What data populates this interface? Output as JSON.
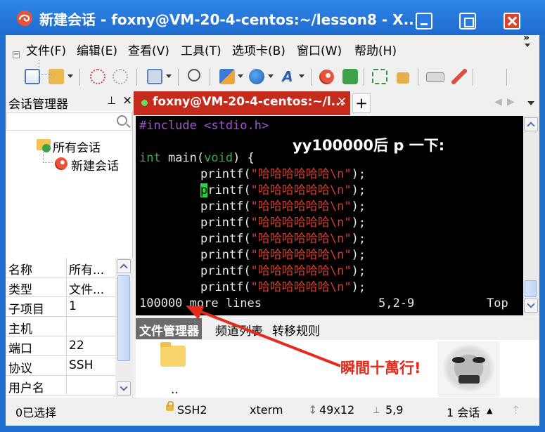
{
  "window": {
    "title": "新建会话 - foxny@VM-20-4-centos:~/lesson8 - X...",
    "accent": "#1f6fd0",
    "tab_color": "#c42b1c"
  },
  "menu": [
    "文件(F)",
    "编辑(E)",
    "查看(V)",
    "工具(T)",
    "选项卡(B)",
    "窗口(W)",
    "帮助(H)"
  ],
  "toolbar_icons": [
    "new-session-icon",
    "open-folder-icon",
    "reconnect-icon",
    "disconnect-icon",
    "properties-icon",
    "find-icon",
    "transfer-icon",
    "globe-icon",
    "font-icon",
    "xshell-icon",
    "xftp-icon",
    "fullscreen-icon",
    "lock-icon",
    "keyboard-icon",
    "highlight-icon"
  ],
  "session_manager": {
    "title": "会话管理器",
    "pin": "ꟼ",
    "close": "×",
    "tree": {
      "root": "所有会话",
      "child": "新建会话"
    },
    "properties": [
      {
        "key": "名称",
        "value": "所有..."
      },
      {
        "key": "类型",
        "value": "文件..."
      },
      {
        "key": "子项目",
        "value": "1"
      },
      {
        "key": "主机",
        "value": ""
      },
      {
        "key": "端口",
        "value": "22"
      },
      {
        "key": "协议",
        "value": "SSH"
      },
      {
        "key": "用户名",
        "value": ""
      }
    ]
  },
  "tab": {
    "label": "foxny@VM-20-4-centos:~/l...",
    "close": "×",
    "add": "+"
  },
  "terminal": {
    "overlay_title": "yy100000后 p 一下:",
    "include_line": "#include <stdio.h>",
    "main_type": "int",
    "main_name": " main(",
    "main_arg": "void",
    "main_rest": ") {",
    "printf_call": "printf(",
    "printf_string": "\"哈哈哈哈哈哈\\n\"",
    "printf_end": ");",
    "printf_lines": 8,
    "cursor_line": 2,
    "status_left": "100000 more lines",
    "status_pos": "5,2-9",
    "status_right": "Top"
  },
  "bottom_tabs": [
    "文件管理器",
    "频道列表",
    "转移规则"
  ],
  "file_manager": {
    "item": ".."
  },
  "annotation": "瞬間十萬行!",
  "statusbar": {
    "selection": "0已选择",
    "protocol": "SSH2",
    "terminal_type": "xterm",
    "size": "49x12",
    "position": "5,9",
    "sessions": "1 会话"
  }
}
